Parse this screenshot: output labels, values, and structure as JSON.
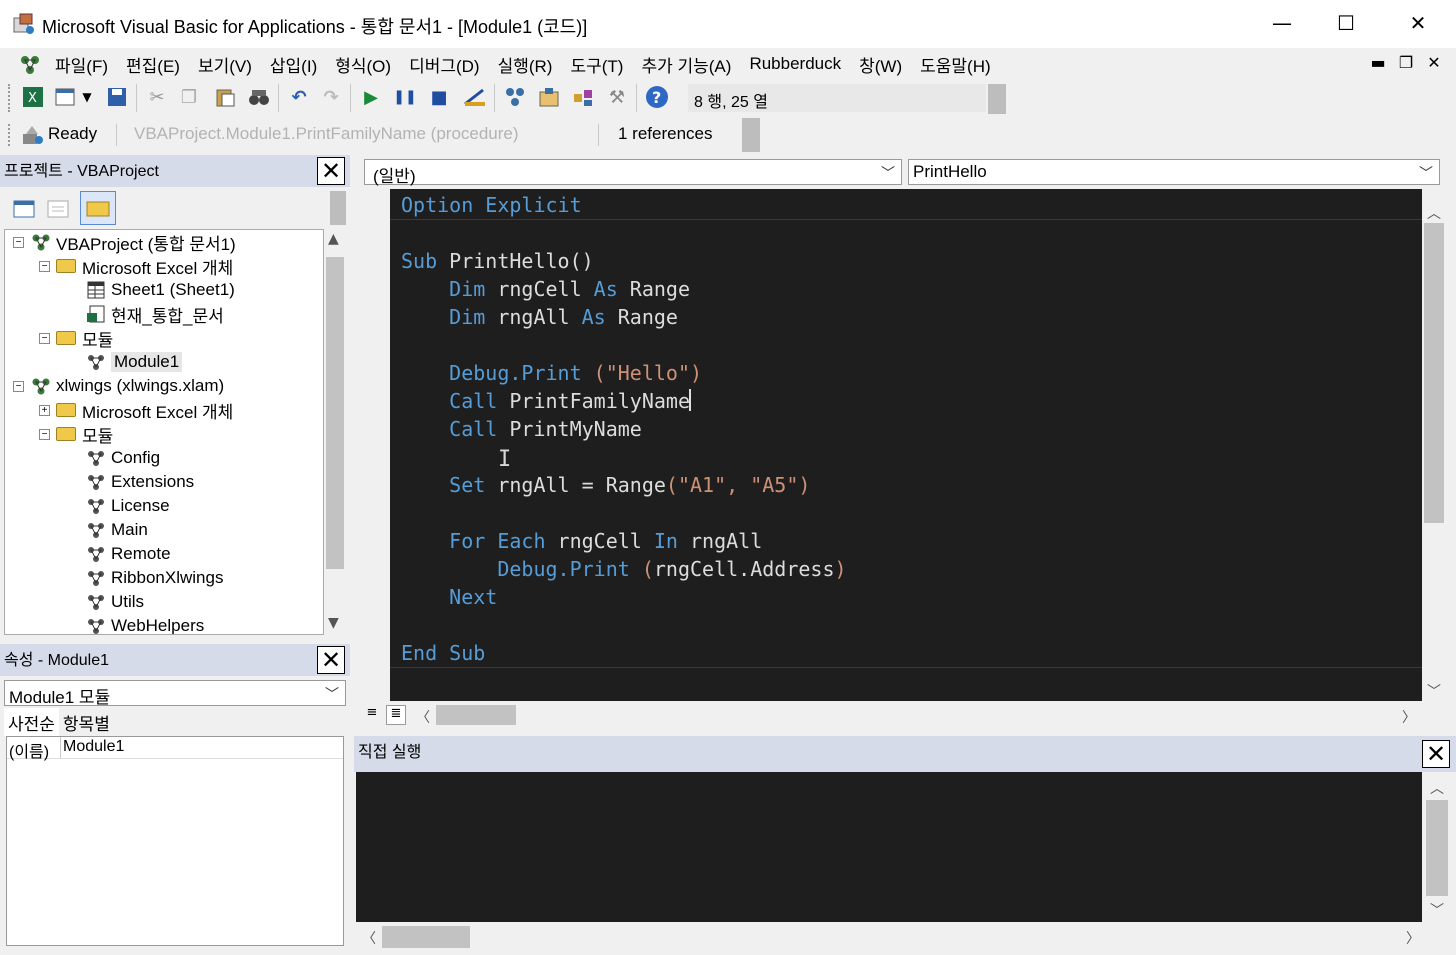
{
  "window": {
    "title": "Microsoft Visual Basic for Applications - 통합 문서1 - [Module1 (코드)]",
    "minimize": "—",
    "maximize": "☐",
    "close": "✕"
  },
  "menu": {
    "items": [
      "파일(F)",
      "편집(E)",
      "보기(V)",
      "삽입(I)",
      "형식(O)",
      "디버그(D)",
      "실행(R)",
      "도구(T)",
      "추가 기능(A)",
      "Rubberduck",
      "창(W)",
      "도움말(H)"
    ],
    "mdi_minimize": "▬",
    "mdi_restore": "❐",
    "mdi_close": "✕"
  },
  "toolbar": {
    "position": "8 행, 25 열",
    "icons": [
      "excel-icon",
      "insert-module-icon",
      "save-icon",
      "cut-icon",
      "copy-icon",
      "paste-icon",
      "find-icon",
      "undo-icon",
      "redo-icon",
      "run-icon",
      "break-icon",
      "reset-icon",
      "design-mode-icon",
      "project-explorer-icon",
      "properties-icon",
      "object-browser-icon",
      "toolbox-icon",
      "help-icon"
    ]
  },
  "rubberduck": {
    "status": "Ready",
    "selection": "VBAProject.Module1.PrintFamilyName (procedure)",
    "references": "1 references"
  },
  "project": {
    "title": "프로젝트 - VBAProject",
    "tree": [
      {
        "label": "VBAProject (통합 문서1)",
        "level": 0,
        "kind": "project",
        "expander": "−"
      },
      {
        "label": "Microsoft Excel 개체",
        "level": 1,
        "kind": "folder",
        "expander": "−"
      },
      {
        "label": "Sheet1 (Sheet1)",
        "level": 2,
        "kind": "sheet"
      },
      {
        "label": "현재_통합_문서",
        "level": 2,
        "kind": "workbook"
      },
      {
        "label": "모듈",
        "level": 1,
        "kind": "folder",
        "expander": "−"
      },
      {
        "label": "Module1",
        "level": 2,
        "kind": "module",
        "selected": true
      },
      {
        "label": "xlwings (xlwings.xlam)",
        "level": 0,
        "kind": "project",
        "expander": "−"
      },
      {
        "label": "Microsoft Excel 개체",
        "level": 1,
        "kind": "folder",
        "expander": "+"
      },
      {
        "label": "모듈",
        "level": 1,
        "kind": "folder",
        "expander": "−"
      },
      {
        "label": "Config",
        "level": 2,
        "kind": "module"
      },
      {
        "label": "Extensions",
        "level": 2,
        "kind": "module"
      },
      {
        "label": "License",
        "level": 2,
        "kind": "module"
      },
      {
        "label": "Main",
        "level": 2,
        "kind": "module"
      },
      {
        "label": "Remote",
        "level": 2,
        "kind": "module"
      },
      {
        "label": "RibbonXlwings",
        "level": 2,
        "kind": "module"
      },
      {
        "label": "Utils",
        "level": 2,
        "kind": "module"
      },
      {
        "label": "WebHelpers",
        "level": 2,
        "kind": "module"
      }
    ]
  },
  "properties": {
    "title": "속성 - Module1",
    "object": "Module1 모듈",
    "tabs": [
      "사전순",
      "항목별"
    ],
    "rows": [
      {
        "name": "(이름)",
        "value": "Module1"
      }
    ]
  },
  "code": {
    "object_select": "(일반)",
    "proc_select": "PrintHello",
    "lines": [
      [
        [
          "kw",
          "Option Explicit"
        ]
      ],
      [],
      [
        [
          "kw",
          "Sub "
        ],
        [
          "id",
          "PrintHello()"
        ]
      ],
      [
        [
          "id",
          "    "
        ],
        [
          "kw",
          "Dim "
        ],
        [
          "id",
          "rngCell "
        ],
        [
          "kw",
          "As "
        ],
        [
          "id",
          "Range"
        ]
      ],
      [
        [
          "id",
          "    "
        ],
        [
          "kw",
          "Dim "
        ],
        [
          "id",
          "rngAll "
        ],
        [
          "kw",
          "As "
        ],
        [
          "id",
          "Range"
        ]
      ],
      [],
      [
        [
          "id",
          "    "
        ],
        [
          "kw",
          "Debug.Print "
        ],
        [
          "str",
          "(\"Hello\")"
        ]
      ],
      [
        [
          "id",
          "    "
        ],
        [
          "kw",
          "Call "
        ],
        [
          "id",
          "PrintFamilyName"
        ]
      ],
      [
        [
          "id",
          "    "
        ],
        [
          "kw",
          "Call "
        ],
        [
          "id",
          "PrintMyName"
        ]
      ],
      [],
      [
        [
          "id",
          "    "
        ],
        [
          "kw",
          "Set "
        ],
        [
          "id",
          "rngAll = Range"
        ],
        [
          "str",
          "(\"A1\", \"A5\")"
        ]
      ],
      [],
      [
        [
          "id",
          "    "
        ],
        [
          "kw",
          "For Each "
        ],
        [
          "id",
          "rngCell "
        ],
        [
          "kw",
          "In "
        ],
        [
          "id",
          "rngAll"
        ]
      ],
      [
        [
          "id",
          "        "
        ],
        [
          "kw",
          "Debug.Print "
        ],
        [
          "str",
          "("
        ],
        [
          "id",
          "rngCell.Address"
        ],
        [
          "str",
          ")"
        ]
      ],
      [
        [
          "id",
          "    "
        ],
        [
          "kw",
          "Next"
        ]
      ],
      [],
      [
        [
          "kw",
          "End Sub"
        ]
      ]
    ]
  },
  "immediate": {
    "title": "직접 실행"
  },
  "colors": {
    "code_bg": "#1e1e1e",
    "keyword": "#569cd6",
    "identifier": "#dcdcdc",
    "string": "#ce9178",
    "panel_header": "#d6dbe9"
  }
}
